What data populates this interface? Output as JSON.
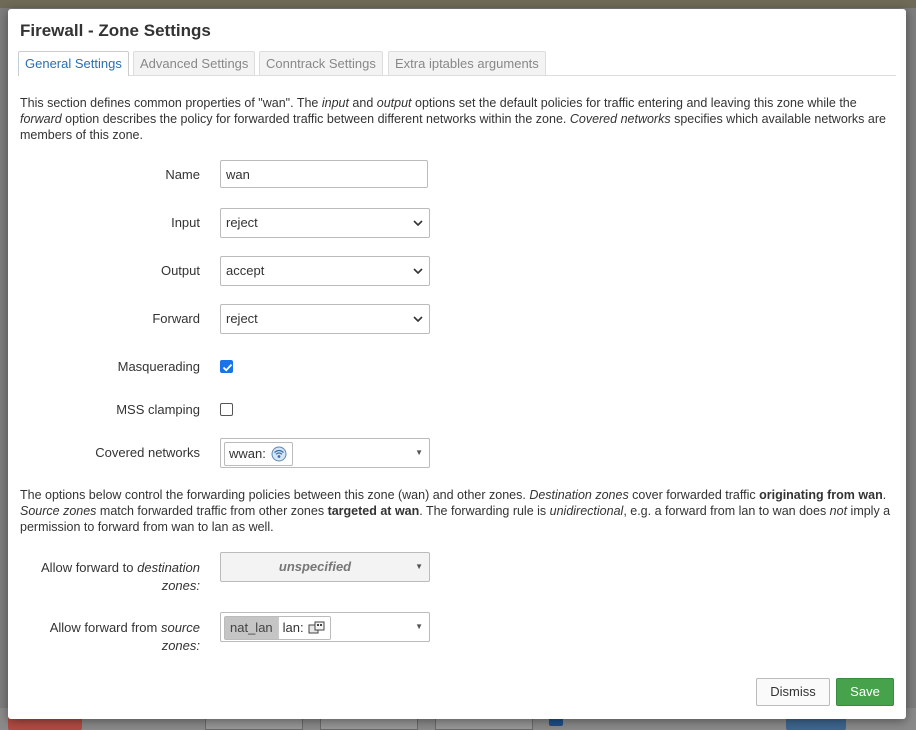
{
  "modal": {
    "title": "Firewall - Zone Settings"
  },
  "tabs": [
    {
      "label": "General Settings",
      "active": true
    },
    {
      "label": "Advanced Settings"
    },
    {
      "label": "Conntrack Settings"
    },
    {
      "label": "Extra iptables arguments"
    }
  ],
  "intro": {
    "p1": "This section defines common properties of \"wan\". The ",
    "i1": "input",
    "p2": " and ",
    "i2": "output",
    "p3": " options set the default policies for traffic entering and leaving this zone while the ",
    "i3": "forward",
    "p4": " option describes the policy for forwarded traffic between different networks within the zone. ",
    "i4": "Covered networks",
    "p5": " specifies which available networks are members of this zone."
  },
  "form": {
    "name": {
      "label": "Name",
      "value": "wan"
    },
    "input": {
      "label": "Input",
      "value": "reject"
    },
    "output": {
      "label": "Output",
      "value": "accept"
    },
    "forward": {
      "label": "Forward",
      "value": "reject"
    },
    "masquerading": {
      "label": "Masquerading",
      "checked": true
    },
    "mss_clamping": {
      "label": "MSS clamping",
      "checked": false
    },
    "covered_networks": {
      "label": "Covered networks",
      "chip": "wwan:",
      "icon": "wireless-icon"
    }
  },
  "forwarding_desc": {
    "p1": "The options below control the forwarding policies between this zone (wan) and other zones. ",
    "i1": "Destination zones",
    "p2": " cover forwarded traffic ",
    "b1": "originating from wan",
    "p3": ". ",
    "i2": "Source zones",
    "p4": " match forwarded traffic from other zones ",
    "b2": "targeted at wan",
    "p5": ". The forwarding rule is ",
    "i3": "unidirectional",
    "p6": ", e.g. a forward from lan to wan does ",
    "i4": "not",
    "p7": " imply a permission to forward from wan to lan as well."
  },
  "forwarding": {
    "dest": {
      "label_pre": "Allow forward to ",
      "label_em": "destination",
      "label_post": "zones:",
      "value": "unspecified"
    },
    "src": {
      "label_pre": "Allow forward from ",
      "label_em": "source",
      "label_post": "zones:",
      "zone_name": "nat_lan",
      "network": "lan:",
      "icon": "ethernet-switch-icon"
    }
  },
  "buttons": {
    "dismiss": "Dismiss",
    "save": "Save"
  },
  "colors": {
    "accent": "#2a6eb5",
    "save": "#47a34b",
    "checkbox": "#1a73e8"
  }
}
